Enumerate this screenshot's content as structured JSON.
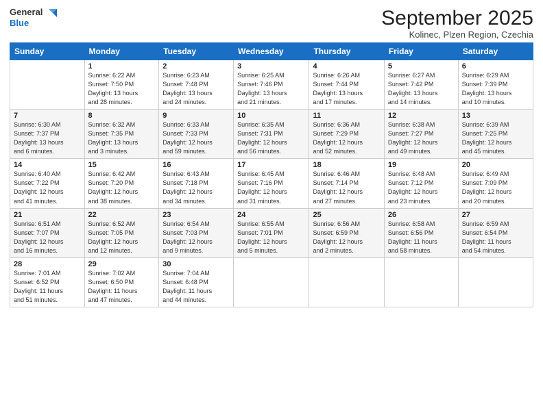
{
  "logo": {
    "general": "General",
    "blue": "Blue"
  },
  "header": {
    "month": "September 2025",
    "location": "Kolinec, Plzen Region, Czechia"
  },
  "weekdays": [
    "Sunday",
    "Monday",
    "Tuesday",
    "Wednesday",
    "Thursday",
    "Friday",
    "Saturday"
  ],
  "weeks": [
    [
      {
        "day": "",
        "info": ""
      },
      {
        "day": "1",
        "info": "Sunrise: 6:22 AM\nSunset: 7:50 PM\nDaylight: 13 hours\nand 28 minutes."
      },
      {
        "day": "2",
        "info": "Sunrise: 6:23 AM\nSunset: 7:48 PM\nDaylight: 13 hours\nand 24 minutes."
      },
      {
        "day": "3",
        "info": "Sunrise: 6:25 AM\nSunset: 7:46 PM\nDaylight: 13 hours\nand 21 minutes."
      },
      {
        "day": "4",
        "info": "Sunrise: 6:26 AM\nSunset: 7:44 PM\nDaylight: 13 hours\nand 17 minutes."
      },
      {
        "day": "5",
        "info": "Sunrise: 6:27 AM\nSunset: 7:42 PM\nDaylight: 13 hours\nand 14 minutes."
      },
      {
        "day": "6",
        "info": "Sunrise: 6:29 AM\nSunset: 7:39 PM\nDaylight: 13 hours\nand 10 minutes."
      }
    ],
    [
      {
        "day": "7",
        "info": "Sunrise: 6:30 AM\nSunset: 7:37 PM\nDaylight: 13 hours\nand 6 minutes."
      },
      {
        "day": "8",
        "info": "Sunrise: 6:32 AM\nSunset: 7:35 PM\nDaylight: 13 hours\nand 3 minutes."
      },
      {
        "day": "9",
        "info": "Sunrise: 6:33 AM\nSunset: 7:33 PM\nDaylight: 12 hours\nand 59 minutes."
      },
      {
        "day": "10",
        "info": "Sunrise: 6:35 AM\nSunset: 7:31 PM\nDaylight: 12 hours\nand 56 minutes."
      },
      {
        "day": "11",
        "info": "Sunrise: 6:36 AM\nSunset: 7:29 PM\nDaylight: 12 hours\nand 52 minutes."
      },
      {
        "day": "12",
        "info": "Sunrise: 6:38 AM\nSunset: 7:27 PM\nDaylight: 12 hours\nand 49 minutes."
      },
      {
        "day": "13",
        "info": "Sunrise: 6:39 AM\nSunset: 7:25 PM\nDaylight: 12 hours\nand 45 minutes."
      }
    ],
    [
      {
        "day": "14",
        "info": "Sunrise: 6:40 AM\nSunset: 7:22 PM\nDaylight: 12 hours\nand 41 minutes."
      },
      {
        "day": "15",
        "info": "Sunrise: 6:42 AM\nSunset: 7:20 PM\nDaylight: 12 hours\nand 38 minutes."
      },
      {
        "day": "16",
        "info": "Sunrise: 6:43 AM\nSunset: 7:18 PM\nDaylight: 12 hours\nand 34 minutes."
      },
      {
        "day": "17",
        "info": "Sunrise: 6:45 AM\nSunset: 7:16 PM\nDaylight: 12 hours\nand 31 minutes."
      },
      {
        "day": "18",
        "info": "Sunrise: 6:46 AM\nSunset: 7:14 PM\nDaylight: 12 hours\nand 27 minutes."
      },
      {
        "day": "19",
        "info": "Sunrise: 6:48 AM\nSunset: 7:12 PM\nDaylight: 12 hours\nand 23 minutes."
      },
      {
        "day": "20",
        "info": "Sunrise: 6:49 AM\nSunset: 7:09 PM\nDaylight: 12 hours\nand 20 minutes."
      }
    ],
    [
      {
        "day": "21",
        "info": "Sunrise: 6:51 AM\nSunset: 7:07 PM\nDaylight: 12 hours\nand 16 minutes."
      },
      {
        "day": "22",
        "info": "Sunrise: 6:52 AM\nSunset: 7:05 PM\nDaylight: 12 hours\nand 12 minutes."
      },
      {
        "day": "23",
        "info": "Sunrise: 6:54 AM\nSunset: 7:03 PM\nDaylight: 12 hours\nand 9 minutes."
      },
      {
        "day": "24",
        "info": "Sunrise: 6:55 AM\nSunset: 7:01 PM\nDaylight: 12 hours\nand 5 minutes."
      },
      {
        "day": "25",
        "info": "Sunrise: 6:56 AM\nSunset: 6:59 PM\nDaylight: 12 hours\nand 2 minutes."
      },
      {
        "day": "26",
        "info": "Sunrise: 6:58 AM\nSunset: 6:56 PM\nDaylight: 11 hours\nand 58 minutes."
      },
      {
        "day": "27",
        "info": "Sunrise: 6:59 AM\nSunset: 6:54 PM\nDaylight: 11 hours\nand 54 minutes."
      }
    ],
    [
      {
        "day": "28",
        "info": "Sunrise: 7:01 AM\nSunset: 6:52 PM\nDaylight: 11 hours\nand 51 minutes."
      },
      {
        "day": "29",
        "info": "Sunrise: 7:02 AM\nSunset: 6:50 PM\nDaylight: 11 hours\nand 47 minutes."
      },
      {
        "day": "30",
        "info": "Sunrise: 7:04 AM\nSunset: 6:48 PM\nDaylight: 11 hours\nand 44 minutes."
      },
      {
        "day": "",
        "info": ""
      },
      {
        "day": "",
        "info": ""
      },
      {
        "day": "",
        "info": ""
      },
      {
        "day": "",
        "info": ""
      }
    ]
  ]
}
